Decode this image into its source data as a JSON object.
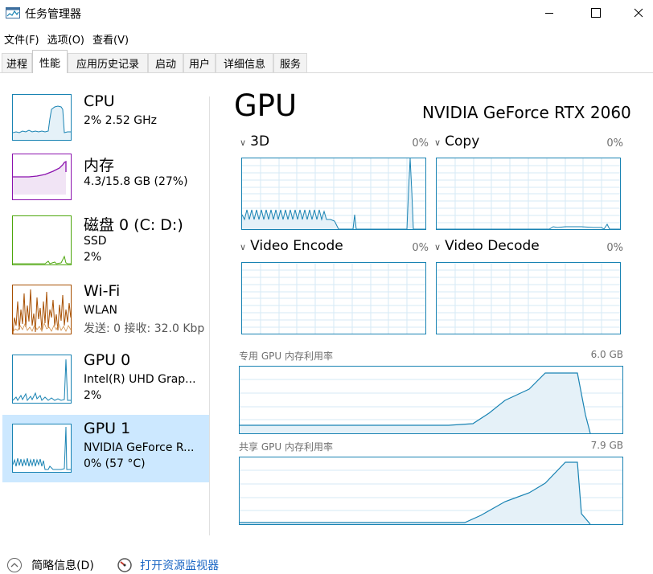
{
  "window": {
    "title": "任务管理器"
  },
  "menu": [
    "文件(F)",
    "选项(O)",
    "查看(V)"
  ],
  "tabs": [
    "进程",
    "性能",
    "应用历史记录",
    "启动",
    "用户",
    "详细信息",
    "服务"
  ],
  "active_tab": "性能",
  "sidebar": [
    {
      "title": "CPU",
      "line1": "2% 2.52 GHz",
      "line2": "",
      "color": "#1983b3"
    },
    {
      "title": "内存",
      "line1": "4.3/15.8 GB (27%)",
      "line2": "",
      "color": "#8b12ae"
    },
    {
      "title": "磁盘 0 (C: D:)",
      "line1": "SSD",
      "line2": "2%",
      "color": "#4da60c"
    },
    {
      "title": "Wi-Fi",
      "line1": "WLAN",
      "line2": "发送: 0 接收: 32.0 Kbp",
      "color": "#a74f01"
    },
    {
      "title": "GPU 0",
      "line1": "Intel(R) UHD Grap...",
      "line2": "2%",
      "color": "#1983b3"
    },
    {
      "title": "GPU 1",
      "line1": "NVIDIA GeForce R...",
      "line2": "0% (57 °C)",
      "color": "#1983b3",
      "selected": true
    }
  ],
  "main": {
    "title": "GPU",
    "gpu_name": "NVIDIA GeForce RTX 2060",
    "engines": [
      {
        "label": "3D",
        "value": "0%"
      },
      {
        "label": "Copy",
        "value": "0%"
      },
      {
        "label": "Video Encode",
        "value": "0%"
      },
      {
        "label": "Video Decode",
        "value": "0%"
      }
    ],
    "dedicated_label": "专用 GPU 内存利用率",
    "dedicated_max": "6.0 GB",
    "shared_label": "共享 GPU 内存利用率",
    "shared_max": "7.9 GB"
  },
  "footer": {
    "summary": "简略信息(D)",
    "monitor": "打开资源监视器"
  },
  "colors": {
    "gpu": "#1983b3",
    "memory": "#8b12ae",
    "disk": "#4da60c",
    "wifi": "#a74f01",
    "selected": "#cce8ff",
    "link": "#1a66c4"
  }
}
